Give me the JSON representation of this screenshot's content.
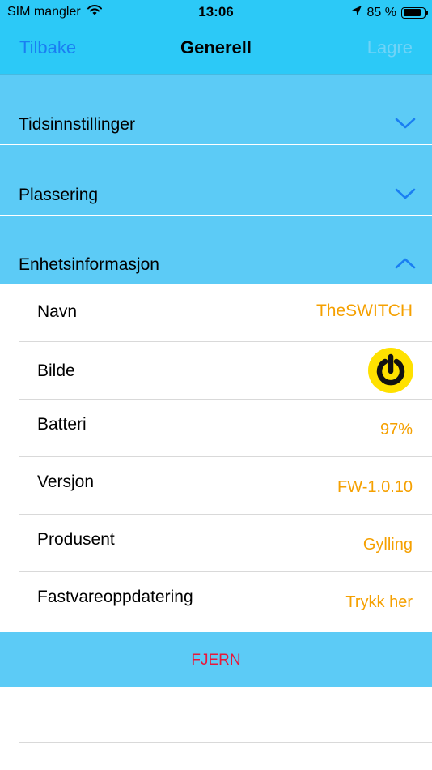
{
  "status_bar": {
    "carrier": "SIM mangler",
    "wifi_icon": "wifi-icon",
    "time": "13:06",
    "location_icon": "location-arrow-icon",
    "battery_percent": "85 %",
    "battery_level": 0.85
  },
  "nav": {
    "back_label": "Tilbake",
    "title": "Generell",
    "save_label": "Lagre"
  },
  "sections": {
    "time_settings": {
      "label": "Tidsinnstillinger",
      "state": "collapsed",
      "icon": "chevron-down-icon"
    },
    "location": {
      "label": "Plassering",
      "state": "collapsed",
      "icon": "chevron-down-icon"
    },
    "device_info": {
      "label": "Enhetsinformasjon",
      "state": "expanded",
      "icon": "chevron-up-icon"
    }
  },
  "device_info": {
    "name": {
      "label": "Navn",
      "value": "TheSWITCH"
    },
    "image": {
      "label": "Bilde",
      "icon": "power-icon"
    },
    "battery": {
      "label": "Batteri",
      "value": "97%"
    },
    "version": {
      "label": "Versjon",
      "value": "FW-1.0.10"
    },
    "manufacturer": {
      "label": "Produsent",
      "value": "Gylling"
    },
    "firmware_update": {
      "label": "Fastvareoppdatering",
      "value": "Trykk her"
    }
  },
  "remove": {
    "label": "FJERN"
  },
  "colors": {
    "header_bg": "#2cc9f7",
    "section_bg": "#5ccbf6",
    "accent_value": "#f5a000",
    "link_blue": "#1a7ef2",
    "danger": "#e8183a",
    "badge_yellow": "#ffe100"
  }
}
